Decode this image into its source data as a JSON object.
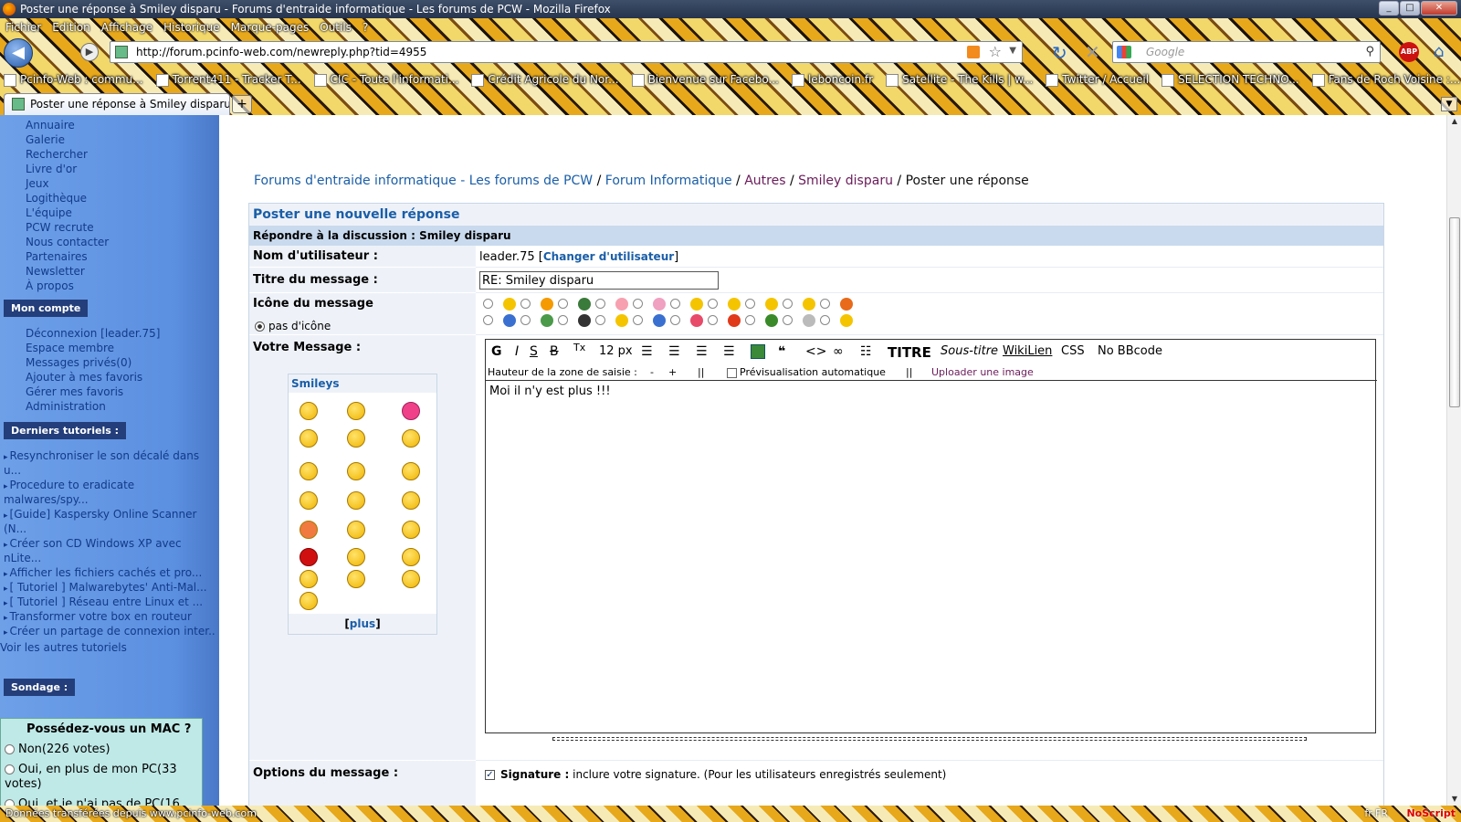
{
  "window": {
    "title": "Poster une réponse à Smiley disparu - Forums d'entraide informatique - Les forums de PCW - Mozilla Firefox"
  },
  "menu": [
    "Fichier",
    "Edition",
    "Affichage",
    "Historique",
    "Marque-pages",
    "Outils",
    "?"
  ],
  "nav": {
    "url": "http://forum.pcinfo-web.com/newreply.php?tid=4955",
    "search_placeholder": "Google",
    "abp": "ABP"
  },
  "bookmarks": [
    "Pcinfo-Web : commu...",
    "Torrent411 - Tracker T...",
    "CIC - Toute l'informati...",
    "Crédit Agricole du Nor...",
    "Bienvenue sur Facebo...",
    "leboncoin.fr",
    "Satellite - The Kills | w...",
    "Twitter / Accueil",
    "SELECTION TECHNO...",
    "Fans de Roch Voisine :..."
  ],
  "tab": {
    "label": "Poster une réponse à Smiley disparu ..."
  },
  "sidebar": {
    "links": [
      "Annuaire",
      "Galerie",
      "Rechercher",
      "Livre d'or",
      "Jeux",
      "Logithèque",
      "L'équipe",
      "PCW recrute",
      "Nous contacter",
      "Partenaires",
      "Newsletter",
      "À propos"
    ],
    "account_header": "Mon compte",
    "account_links": [
      "Déconnexion [leader.75]",
      "Espace membre",
      "Messages privés(0)",
      "Ajouter à mes favoris",
      "Gérer mes favoris",
      "Administration"
    ],
    "tutorials_header": "Derniers tutoriels :",
    "tutorials": [
      "Resynchroniser le son décalé dans",
      "u...",
      "Procedure to eradicate",
      "malwares/spy...",
      "[Guide] Kaspersky Online Scanner",
      "(N...",
      "Créer son CD Windows XP avec",
      "nLite...",
      "Afficher les fichiers cachés et pro...",
      "[ Tutoriel ] Malwarebytes' Anti-Mal...",
      "[ Tutoriel ] Réseau entre Linux et ...",
      "Transformer votre box en routeur",
      "Créer un partage de connexion inter..."
    ],
    "more_tutorials": "Voir les autres tutoriels",
    "poll_header": "Sondage :",
    "poll_question": "Possédez-vous un MAC ?",
    "poll_options": [
      "Non(226 votes)",
      "Oui, en plus de mon PC(33",
      "votes)",
      "Oui, et je n'ai pas de PC(16"
    ]
  },
  "breadcrumb": {
    "forum": "Forums d'entraide informatique - Les forums de PCW",
    "sep": "/",
    "category": "Forum Informatique",
    "sub": "Autres",
    "thread": "Smiley disparu",
    "current": "Poster une réponse"
  },
  "form": {
    "title": "Poster une nouvelle réponse",
    "subtitle": "Répondre à la discussion : Smiley disparu",
    "username_label": "Nom d'utilisateur :",
    "username": "leader.75",
    "change_user": "Changer d'utilisateur",
    "msg_title_label": "Titre du message :",
    "msg_title_value": "RE: Smiley disparu",
    "icon_label": "Icône du message",
    "no_icon": "pas d'icône",
    "message_label": "Votre Message :",
    "smileys_header": "Smileys",
    "smileys_more": "plus",
    "options_label": "Options du message :",
    "signature_bold": "Signature :",
    "signature_text": "inclure votre signature. (Pour les utilisateurs enregistrés seulement)"
  },
  "editor": {
    "toolbar": [
      "G",
      "I",
      "S",
      "B",
      "Tx",
      "12 px",
      "TITRE",
      "Sous-titre",
      "WikiLien",
      "CSS",
      "No BBcode"
    ],
    "height_label": "Hauteur de la zone de saisie :",
    "minus": "-",
    "plus": "+",
    "sep": "||",
    "autopreview": "Prévisualisation automatique",
    "upload": "Uploader une image",
    "content": "Moi il n'y est plus !!!"
  },
  "status": {
    "text": "Données transférées depuis www.pcinfo-web.com",
    "lang": "fr-FR",
    "noscript": "NoScript"
  },
  "colors": {
    "link": "#1a5ea8",
    "visited": "#6a1b5a",
    "sidebar": "#5b8fe0",
    "header_bg": "#eef2f8",
    "sub_bg": "#c9daee"
  }
}
